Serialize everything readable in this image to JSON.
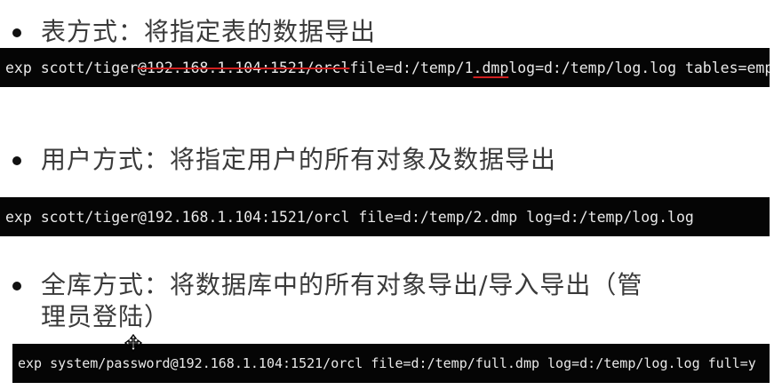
{
  "sections": [
    {
      "heading": "表方式：将指定表的数据导出",
      "command": {
        "prefix": "exp scott/tiger",
        "struck": "@192.168.1.104:1521/orcl",
        "mid": " file=d:/temp/1",
        "underlined": ".dmp",
        "suffix": " log=d:/temp/log.log tables=emp,dept"
      }
    },
    {
      "heading": "用户方式：将指定用户的所有对象及数据导出",
      "command": "exp scott/tiger@192.168.1.104:1521/orcl file=d:/temp/2.dmp log=d:/temp/log.log"
    },
    {
      "heading_line1": "全库方式：将数据库中的所有对象导出/导入导出（管",
      "heading_line2": "理员登陆）",
      "command": "exp system/password@192.168.1.104:1521/orcl  file=d:/temp/full.dmp log=d:/temp/log.log full=y"
    }
  ],
  "cursor_icon": "move-cursor-icon"
}
